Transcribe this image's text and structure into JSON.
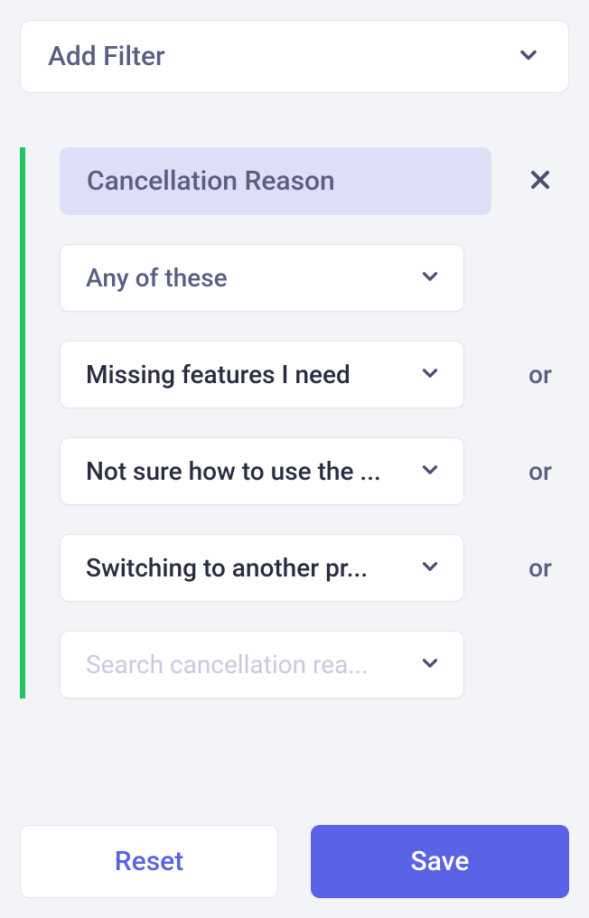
{
  "addFilter": {
    "label": "Add Filter"
  },
  "filter": {
    "chip": "Cancellation Reason",
    "condition": "Any of these",
    "values": [
      "Missing features I need",
      "Not sure how to use the ...",
      "Switching to another pr..."
    ],
    "orLabel": "or",
    "searchPlaceholder": "Search cancellation rea..."
  },
  "buttons": {
    "reset": "Reset",
    "save": "Save"
  }
}
